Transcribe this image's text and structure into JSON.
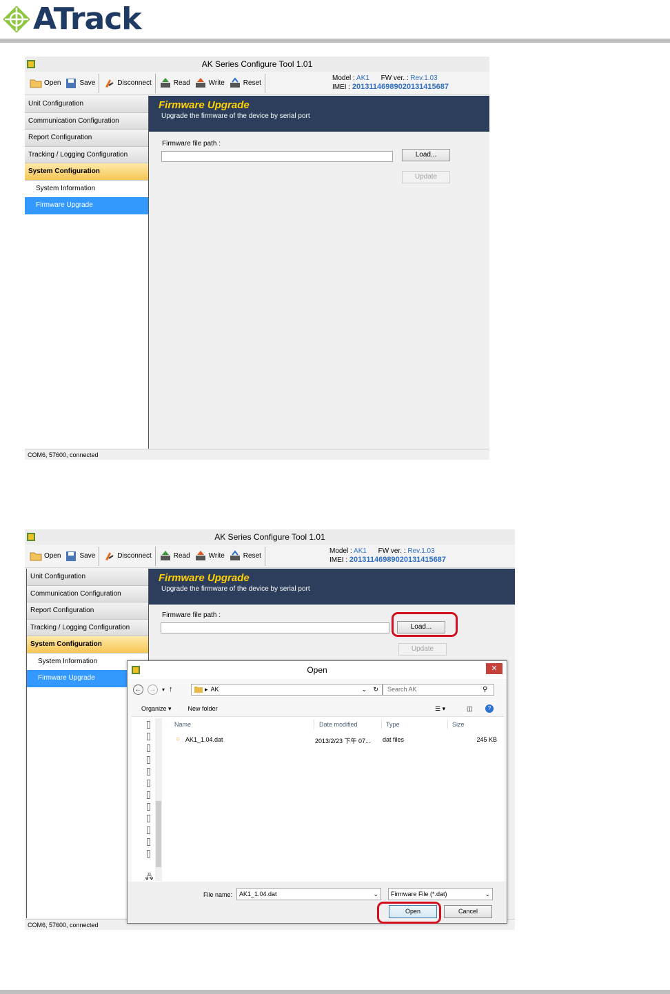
{
  "brand": {
    "name": "ATrack",
    "color": "#1f3b63",
    "mark_color": "#8dc63f"
  },
  "app": {
    "title": "AK Series Configure Tool 1.01",
    "toolbar": [
      {
        "label": "Open",
        "icon": "folder-icon"
      },
      {
        "label": "Save",
        "icon": "floppy-disk-icon"
      },
      {
        "label": "Disconnect",
        "icon": "disconnect-plug-icon"
      },
      {
        "label": "Read",
        "icon": "read-device-icon"
      },
      {
        "label": "Write",
        "icon": "write-device-icon"
      },
      {
        "label": "Reset",
        "icon": "reset-device-icon"
      }
    ],
    "device": {
      "model_label": "Model :",
      "model_value": "AK1",
      "fw_label": "FW ver. :",
      "fw_value": "Rev.1.03",
      "imei_label": "IMEI :",
      "imei_value": "201311469890201314156​87"
    },
    "sidebar": {
      "items": [
        {
          "label": "Unit Configuration"
        },
        {
          "label": "Communication Configuration"
        },
        {
          "label": "Report Configuration"
        },
        {
          "label": "Tracking / Logging Configuration"
        },
        {
          "label": "System Configuration",
          "active": true
        }
      ],
      "subitems": [
        {
          "label": "System Information"
        },
        {
          "label": "Firmware Upgrade",
          "selected": true
        }
      ]
    },
    "banner": {
      "title": "Firmware Upgrade",
      "subtitle": "Upgrade the firmware of the device by serial port"
    },
    "form": {
      "file_path_label": "Firmware file path :",
      "file_path_value": "",
      "load_label": "Load...",
      "update_label": "Update"
    },
    "status": "COM6, 57600, connected",
    "colors": {
      "banner_bg": "#2d3e5c",
      "banner_title": "#ffd200",
      "selection": "#3399ff",
      "active_nav": "#f6c655",
      "highlight": "#d0101e"
    }
  },
  "dialog": {
    "title": "Open",
    "close_label": "✕",
    "breadcrumb": "AK",
    "search_placeholder": "Search AK",
    "organize_label": "Organize ▾",
    "new_folder_label": "New folder",
    "columns": {
      "name": "Name",
      "date": "Date modified",
      "type": "Type",
      "size": "Size"
    },
    "files": [
      {
        "name": "AK1_1.04.dat",
        "date": "2013/2/23 下午 07...",
        "type": "dat files",
        "size": "245 KB"
      }
    ],
    "file_name_label": "File name:",
    "file_name_value": "AK1_1.04.dat",
    "filter_value": "Firmware File (*.dat)",
    "open_label": "Open",
    "cancel_label": "Cancel"
  }
}
